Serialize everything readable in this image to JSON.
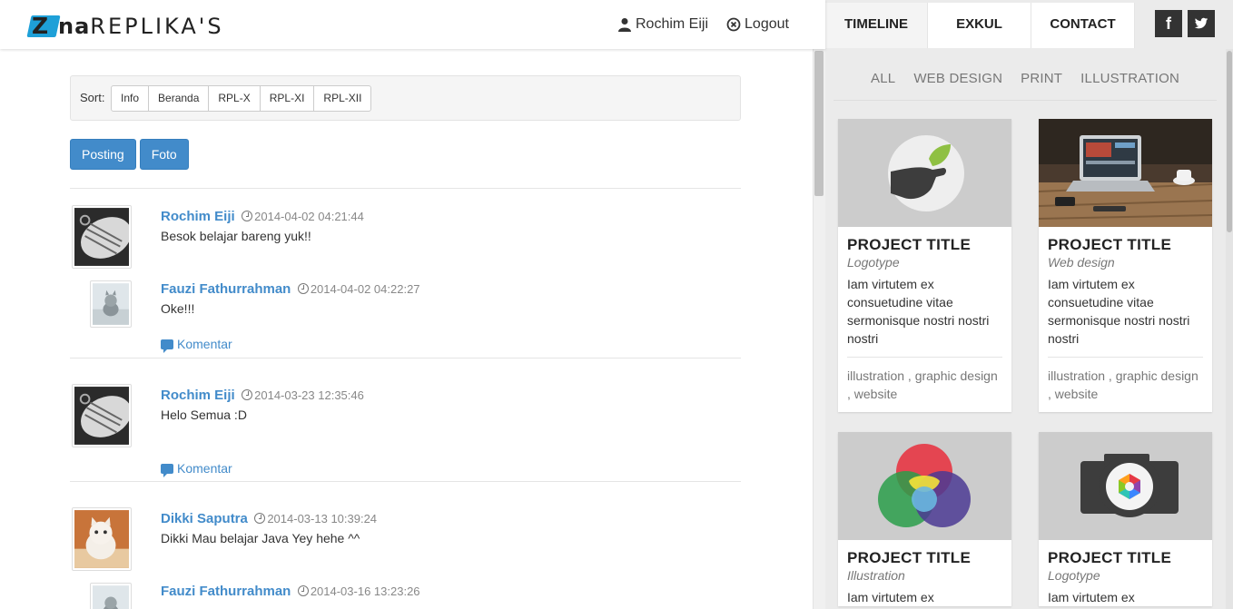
{
  "header": {
    "logo_prefix": "Z",
    "logo_mid": "na",
    "logo_rest": "REPLIKA'S",
    "user_name": "Rochim Eiji",
    "logout_label": "Logout"
  },
  "nav": {
    "tabs": [
      "TIMELINE",
      "EXKUL",
      "CONTACT"
    ],
    "social": [
      "f",
      "t"
    ]
  },
  "sort": {
    "label": "Sort:",
    "options": [
      "Info",
      "Beranda",
      "RPL-X",
      "RPL-XI",
      "RPL-XII"
    ]
  },
  "actions": [
    "Posting",
    "Foto"
  ],
  "feed": {
    "komentar_label": "Komentar",
    "posts": [
      {
        "author": "Rochim Eiji",
        "time": "2014-04-02 04:21:44",
        "text": "Besok belajar bareng yuk!!",
        "reply": {
          "author": "Fauzi Fathurrahman",
          "time": "2014-04-02 04:22:27",
          "text": "Oke!!!"
        }
      },
      {
        "author": "Rochim Eiji",
        "time": "2014-03-23 12:35:46",
        "text": "Helo Semua :D"
      },
      {
        "author": "Dikki Saputra",
        "time": "2014-03-13 10:39:24",
        "text": "Dikki Mau belajar Java Yey hehe ^^",
        "reply": {
          "author": "Fauzi Fathurrahman",
          "time": "2014-03-16 13:23:26",
          "text": ""
        }
      }
    ]
  },
  "filters": [
    "ALL",
    "WEB DESIGN",
    "PRINT",
    "ILLUSTRATION"
  ],
  "projects": [
    {
      "title": "PROJECT TITLE",
      "category": "Logotype",
      "desc": "Iam virtutem ex consuetudine vitae sermonisque nostri nostri nostri",
      "tags": "illustration , graphic design , website",
      "image": "hand-logo"
    },
    {
      "title": "PROJECT TITLE",
      "category": "Web design",
      "desc": "Iam virtutem ex consuetudine vitae sermonisque nostri nostri nostri",
      "tags": "illustration , graphic design , website",
      "image": "laptop-photo"
    },
    {
      "title": "PROJECT TITLE",
      "category": "Illustration",
      "desc": "Iam virtutem ex",
      "tags": "",
      "image": "color-circles"
    },
    {
      "title": "PROJECT TITLE",
      "category": "Logotype",
      "desc": "Iam virtutem ex",
      "tags": "",
      "image": "camera-icon"
    }
  ],
  "colors": {
    "accent": "#428bca",
    "logo_blue": "#1ea0d8",
    "dark": "#333333"
  }
}
